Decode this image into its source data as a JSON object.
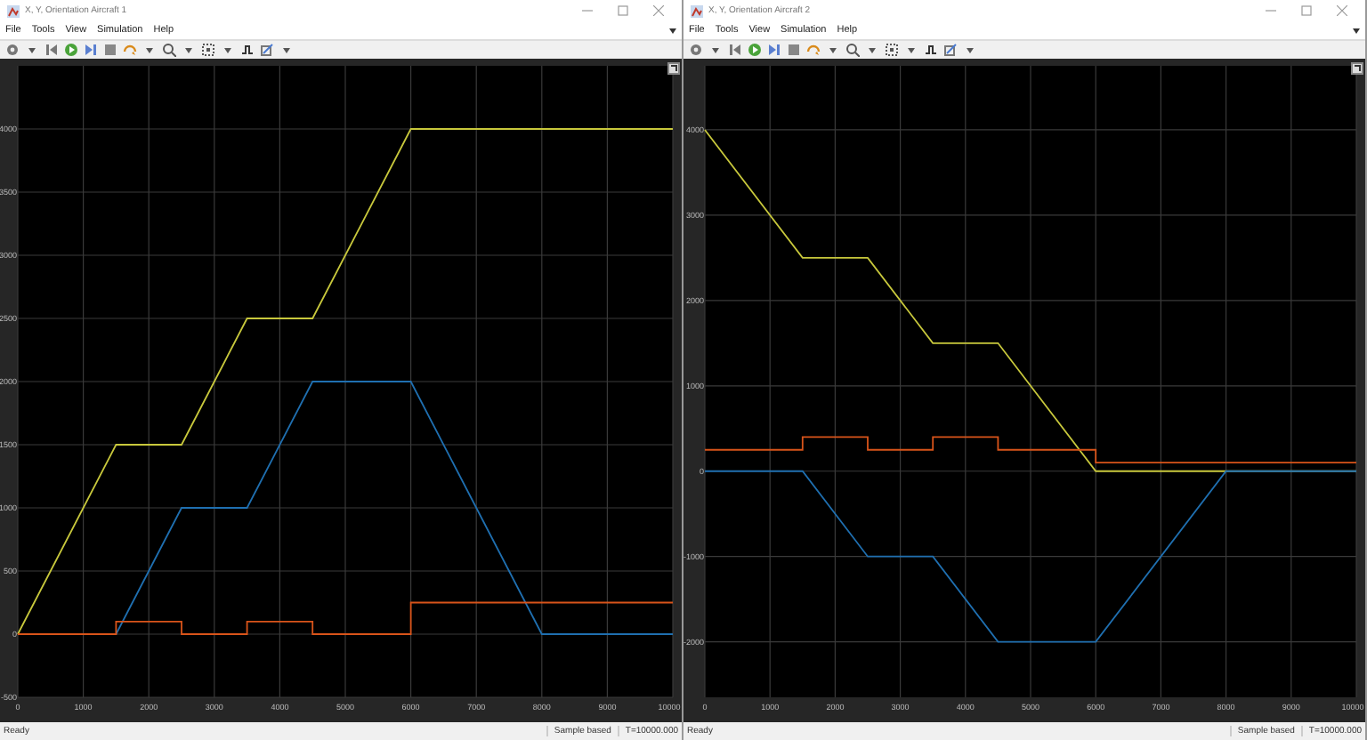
{
  "windows": [
    {
      "title": "X, Y, Orientation Aircraft 1",
      "menu": [
        "File",
        "Tools",
        "View",
        "Simulation",
        "Help"
      ],
      "plot": {
        "chart_data": {
          "type": "line",
          "x": [
            0,
            1500,
            1500,
            2500,
            2500,
            3500,
            3500,
            4500,
            4500,
            6000,
            6000,
            8000,
            10000
          ],
          "series": [
            {
              "color": "#c8c83c",
              "values": [
                0,
                1500,
                1500,
                1500,
                1500,
                2500,
                2500,
                2500,
                2500,
                4000,
                4000,
                4000,
                4000
              ]
            },
            {
              "color": "#1f6fb0",
              "values": [
                0,
                0,
                0,
                1000,
                1000,
                1000,
                1000,
                2000,
                2000,
                2000,
                2000,
                0,
                0
              ]
            },
            {
              "color": "#d9541a",
              "values": [
                0,
                0,
                100,
                100,
                0,
                0,
                100,
                100,
                0,
                0,
                250,
                250,
                250
              ]
            }
          ],
          "grid": true,
          "xlim": [
            0,
            10000
          ],
          "ylim": [
            -500,
            4500
          ],
          "xticks": [
            0,
            1000,
            2000,
            3000,
            4000,
            5000,
            6000,
            7000,
            8000,
            9000,
            10000
          ],
          "yticks": [
            -500,
            0,
            500,
            1000,
            1500,
            2000,
            2500,
            3000,
            3500,
            4000
          ]
        }
      },
      "status_bar": {
        "state": "Ready",
        "mode": "Sample based",
        "time": "T=10000.000"
      }
    },
    {
      "title": "X, Y, Orientation Aircraft 2",
      "menu": [
        "File",
        "Tools",
        "View",
        "Simulation",
        "Help"
      ],
      "plot": {
        "chart_data": {
          "type": "line",
          "x": [
            0,
            1500,
            1500,
            2500,
            2500,
            3500,
            3500,
            4500,
            4500,
            6000,
            6000,
            8000,
            10000
          ],
          "series": [
            {
              "color": "#c8c83c",
              "values": [
                4000,
                2500,
                2500,
                2500,
                2500,
                1500,
                1500,
                1500,
                1500,
                0,
                0,
                0,
                0
              ]
            },
            {
              "color": "#1f6fb0",
              "values": [
                0,
                0,
                0,
                -1000,
                -1000,
                -1000,
                -1000,
                -2000,
                -2000,
                -2000,
                -2000,
                0,
                0
              ]
            },
            {
              "color": "#d9541a",
              "values": [
                250,
                250,
                400,
                400,
                250,
                250,
                400,
                400,
                250,
                250,
                100,
                100,
                100
              ]
            }
          ],
          "grid": true,
          "xlim": [
            0,
            10000
          ],
          "ylim": [
            -2650,
            4750
          ],
          "xticks": [
            0,
            1000,
            2000,
            3000,
            4000,
            5000,
            6000,
            7000,
            8000,
            9000,
            10000
          ],
          "yticks": [
            -2000,
            -1000,
            0,
            1000,
            2000,
            3000,
            4000
          ]
        }
      },
      "status_bar": {
        "state": "Ready",
        "mode": "Sample based",
        "time": "T=10000.000"
      }
    }
  ]
}
